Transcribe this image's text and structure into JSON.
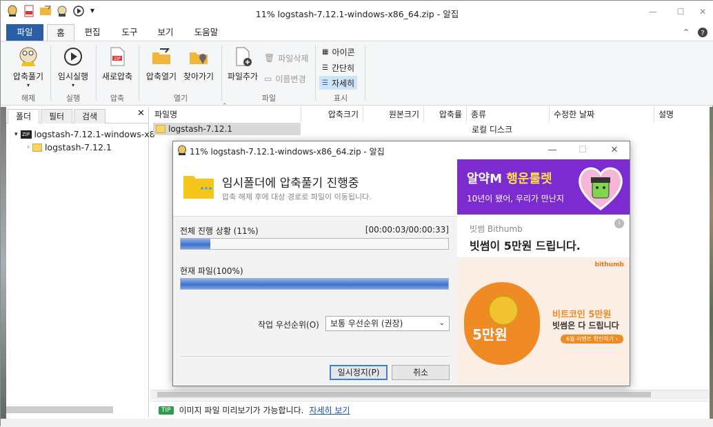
{
  "window": {
    "title": "11% logstash-7.12.1-windows-x86_64.zip - 알집"
  },
  "ribbon_tabs": [
    "파일",
    "홈",
    "편집",
    "도구",
    "보기",
    "도움말"
  ],
  "ribbon": {
    "extract": "압축풀기",
    "group_extract": "해제",
    "temp_run": "임시실행",
    "group_run": "실행",
    "new_zip": "새로압축",
    "group_zip": "압축",
    "open_zip": "압축열기",
    "find": "찾아가기",
    "group_open": "열기",
    "add_file": "파일추가",
    "delete_file": "파일삭제",
    "rename": "이름변경",
    "group_file": "파일",
    "view_icon": "아이콘",
    "view_simple": "간단히",
    "view_detail": "자세히",
    "group_view": "표시"
  },
  "left_panel": {
    "tabs": [
      "폴더",
      "필터",
      "검색"
    ],
    "tree": [
      "logstash-7.12.1-windows-x8",
      "logstash-7.12.1"
    ]
  },
  "file_list": {
    "columns": [
      "파일명",
      "압축크기",
      "원본크기",
      "압축률",
      "종류",
      "수정한 날짜",
      "설명"
    ],
    "rows": [
      {
        "name": "logstash-7.12.1",
        "type": "로컬 디스크"
      }
    ]
  },
  "tip": {
    "badge": "TIP",
    "text": "이미지 파일 미리보기가 가능합니다.",
    "link": "자세히 보기"
  },
  "dialog": {
    "title": "11% logstash-7.12.1-windows-x86_64.zip - 알집",
    "heading": "임시폴더에 압축풀기 진행중",
    "subheading": "압축 해제 후에 대상 경로로 파일이 이동됩니다.",
    "overall_label": "전체 진행 상황 (11%)",
    "overall_time": "[00:00:03/00:00:33]",
    "overall_progress": 11,
    "current_label": "현재 파일(100%)",
    "current_progress": 100,
    "priority_label": "작업 우선순위(O)",
    "priority_value": "보통 우선순위 (권장)",
    "pause_button": "일시정지(P)",
    "cancel_button": "취소"
  },
  "ad": {
    "top_line1_a": "알약M",
    "top_line1_b": "행운룰렛",
    "top_line2": "10년이 됐어, 우리가 만난지",
    "advertiser": "빗썸 Bithumb",
    "headline": "빗썸이 5만원 드립니다.",
    "logo": "bithumb",
    "coin_text": "5만원",
    "promo1": "비트코인 5만원",
    "promo2": "빗썸은 다 드립니다",
    "promo_button": "6월 이벤트 확인하기 ›"
  },
  "colors": {
    "file_tab": "#2a5fa8",
    "progress": "#4f7fd4",
    "ad_purple": "#7b2bd0",
    "ad_orange": "#f08a24"
  }
}
